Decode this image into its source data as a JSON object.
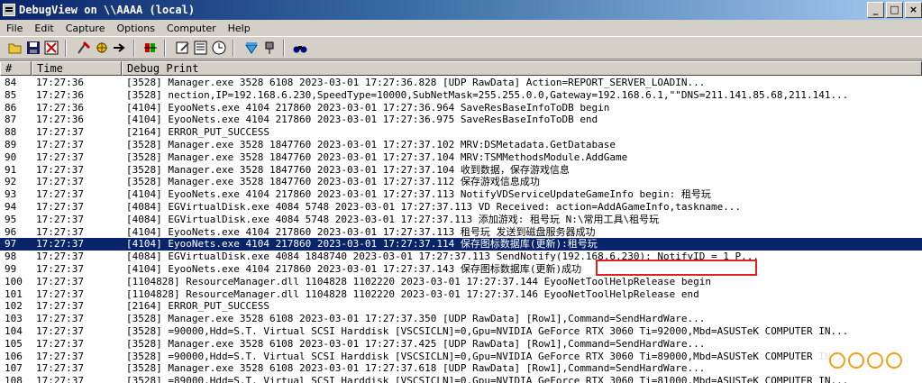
{
  "window": {
    "title": "DebugView on \\\\AAAA (local)",
    "controls": [
      "_",
      "□",
      "×"
    ]
  },
  "menu": [
    "File",
    "Edit",
    "Capture",
    "Options",
    "Computer",
    "Help"
  ],
  "toolbar": [
    "open-icon",
    "save-icon",
    "clear-display-icon",
    "capture-icon",
    "autoscroll-icon",
    "filter-icon",
    "history-depth-icon",
    "find-icon"
  ],
  "columns": {
    "num": "#",
    "time": "Time",
    "msg": "Debug Print"
  },
  "selected_row": "97",
  "highlighted_row": "99",
  "rows": [
    {
      "n": "84",
      "t": "17:27:36",
      "m": "[3528] Manager.exe                3528       6108       2023-03-01 17:27:36.828  [UDP RawData] Action=REPORT_SERVER_LOADIN..."
    },
    {
      "n": "85",
      "t": "17:27:36",
      "m": "[3528] nection,IP=192.168.6.230,SpeedType=10000,SubNetMask=255.255.0.0,Gateway=192.168.6.1,\"\"DNS=211.141.85.68,211.141..."
    },
    {
      "n": "86",
      "t": "17:27:36",
      "m": "[4104] EyooNets.exe               4104       217860     2023-03-01 17:27:36.964  SaveResBaseInfoToDB begin"
    },
    {
      "n": "87",
      "t": "17:27:36",
      "m": "[4104] EyooNets.exe               4104       217860     2023-03-01 17:27:36.975  SaveResBaseInfoToDB end"
    },
    {
      "n": "88",
      "t": "17:27:37",
      "m": "[2164] ERROR_PUT_SUCCESS"
    },
    {
      "n": "89",
      "t": "17:27:37",
      "m": "[3528] Manager.exe                3528       1847760    2023-03-01 17:27:37.102  MRV:DSMetadata.GetDatabase"
    },
    {
      "n": "90",
      "t": "17:27:37",
      "m": "[3528] Manager.exe                3528       1847760    2023-03-01 17:27:37.104  MRV:TSMMethodsModule.AddGame"
    },
    {
      "n": "91",
      "t": "17:27:37",
      "m": "[3528] Manager.exe                3528       1847760    2023-03-01 17:27:37.104  收到数据，保存游戏信息"
    },
    {
      "n": "92",
      "t": "17:27:37",
      "m": "[3528] Manager.exe                3528       1847760    2023-03-01 17:27:37.112  保存游戏信息成功"
    },
    {
      "n": "93",
      "t": "17:27:37",
      "m": "[4104] EyooNets.exe               4104       217860     2023-03-01 17:27:37.113  NotifyVDServiceUpdateGameInfo begin: 租号玩"
    },
    {
      "n": "94",
      "t": "17:27:37",
      "m": "[4084] EGVirtualDisk.exe          4084       5748       2023-03-01 17:27:37.113  VD Received: action=AddAGameInfo,taskname..."
    },
    {
      "n": "95",
      "t": "17:27:37",
      "m": "[4084] EGVirtualDisk.exe          4084       5748       2023-03-01 17:27:37.113  添加游戏: 租号玩 N:\\常用工具\\租号玩"
    },
    {
      "n": "96",
      "t": "17:27:37",
      "m": "[4104] EyooNets.exe               4104       217860     2023-03-01 17:27:37.113  租号玩 发送到磁盘服务器成功"
    },
    {
      "n": "97",
      "t": "17:27:37",
      "m": "[4104] EyooNets.exe               4104       217860     2023-03-01 17:27:37.114  保存图标数据库(更新):租号玩"
    },
    {
      "n": "98",
      "t": "17:27:37",
      "m": "[4084] EGVirtualDisk.exe          4084       1848740    2023-03-01 17:27:37.113  SendNotify(192.168.6.230): NotifyID = 1 P..."
    },
    {
      "n": "99",
      "t": "17:27:37",
      "m": "[4104] EyooNets.exe               4104       217860     2023-03-01 17:27:37.143  保存图标数据库(更新)成功"
    },
    {
      "n": "100",
      "t": "17:27:37",
      "m": "[1104828] ResourceManager.dll         1104828    1102220    2023-03-01 17:27:37.144  EyooNetToolHelpRelease begin"
    },
    {
      "n": "101",
      "t": "17:27:37",
      "m": "[1104828] ResourceManager.dll         1104828    1102220    2023-03-01 17:27:37.146  EyooNetToolHelpRelease end"
    },
    {
      "n": "102",
      "t": "17:27:37",
      "m": "[2164] ERROR_PUT_SUCCESS"
    },
    {
      "n": "103",
      "t": "17:27:37",
      "m": "[3528] Manager.exe                3528       6108       2023-03-01 17:27:37.350  [UDP RawData] [Row1],Command=SendHardWare..."
    },
    {
      "n": "104",
      "t": "17:27:37",
      "m": "[3528] =90000,Hdd=S.T. Virtual SCSI Harddisk [VSCSICLN]=0,Gpu=NVIDIA GeForce RTX 3060 Ti=92000,Mbd=ASUSTeK COMPUTER IN..."
    },
    {
      "n": "105",
      "t": "17:27:37",
      "m": "[3528] Manager.exe                3528       6108       2023-03-01 17:27:37.425  [UDP RawData] [Row1],Command=SendHardWare..."
    },
    {
      "n": "106",
      "t": "17:27:37",
      "m": "[3528] =90000,Hdd=S.T. Virtual SCSI Harddisk [VSCSICLN]=0,Gpu=NVIDIA GeForce RTX 3060 Ti=89000,Mbd=ASUSTeK COMPUTER IN..."
    },
    {
      "n": "107",
      "t": "17:27:37",
      "m": "[3528] Manager.exe                3528       6108       2023-03-01 17:27:37.618  [UDP RawData] [Row1],Command=SendHardWare..."
    },
    {
      "n": "108",
      "t": "17:27:37",
      "m": "[3528] =89000,Hdd=S.T. Virtual SCSI Harddisk [VSCSICLN]=0,Gpu=NVIDIA GeForce RTX 3060 Ti=81000,Mbd=ASUSTeK COMPUTER IN..."
    }
  ]
}
